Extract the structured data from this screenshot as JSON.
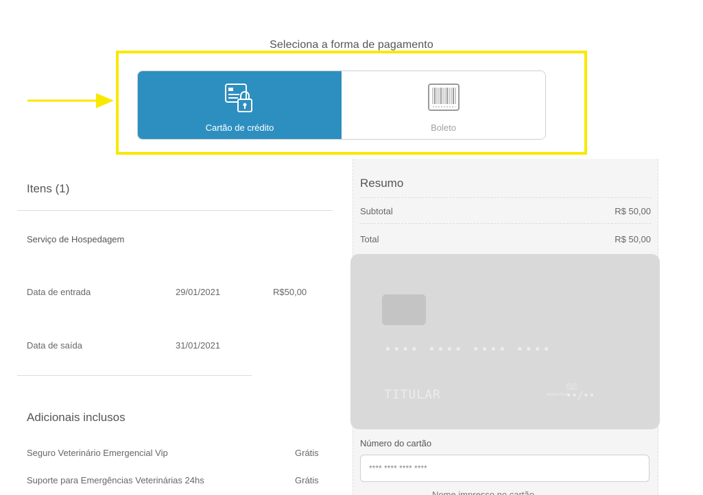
{
  "payment": {
    "title": "Seleciona a forma de pagamento",
    "options": [
      {
        "label": "Cartão de crédito",
        "icon": "credit-card-lock-icon",
        "selected": true
      },
      {
        "label": "Boleto",
        "icon": "barcode-icon",
        "selected": false
      }
    ],
    "active_color": "#2d8fc0",
    "highlight_color": "#f9e800"
  },
  "items": {
    "title": "Itens (1)",
    "service": "Serviço de Hospedagem",
    "rows": [
      {
        "label": "Data de entrada",
        "date": "29/01/2021",
        "price": "R$50,00"
      },
      {
        "label": "Data de saída",
        "date": "31/01/2021",
        "price": ""
      }
    ]
  },
  "extras": {
    "title": "Adicionais inclusos",
    "list": [
      {
        "name": "Seguro Veterinário Emergencial Vip",
        "price": "Grátis"
      },
      {
        "name": "Suporte para Emergências Veterinárias 24hs",
        "price": "Grátis"
      }
    ]
  },
  "summary": {
    "title": "Resumo",
    "subtotal_label": "Subtotal",
    "subtotal_value": "R$ 50,00",
    "total_label": "Total",
    "total_value": "R$ 50,00"
  },
  "card_preview": {
    "number": "•••• •••• •••• ••••",
    "holder": "TITULAR",
    "valid_label": "VALID THRU",
    "month_label": "MONTH/YEAR",
    "expiry": "••/••"
  },
  "form": {
    "card_number_label": "Número do cartão",
    "card_number_placeholder": "**** **** **** ****",
    "next_label_partial": "Nome impresso no cartão"
  }
}
